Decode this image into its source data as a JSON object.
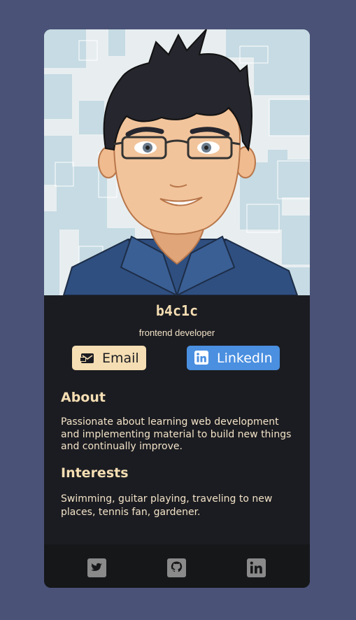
{
  "profile": {
    "name": "b4c1c",
    "role": "frontend developer"
  },
  "buttons": {
    "email_label": "Email",
    "linkedin_label": "LinkedIn"
  },
  "about": {
    "title": "About",
    "text": "Passionate about learning web development and implementing material to build new things and continually improve."
  },
  "interests": {
    "title": "Interests",
    "text": "Swimming, guitar playing, traveling to new places, tennis fan, gardener."
  },
  "footer": {
    "icons": [
      "twitter-icon",
      "github-icon",
      "linkedin-icon"
    ]
  },
  "colors": {
    "background": "#4a5278",
    "card": "#1b1c21",
    "accent": "#f5deb3",
    "linkedin": "#4a8fe0",
    "footer": "#161719",
    "social_icon": "#8a8a8a"
  }
}
